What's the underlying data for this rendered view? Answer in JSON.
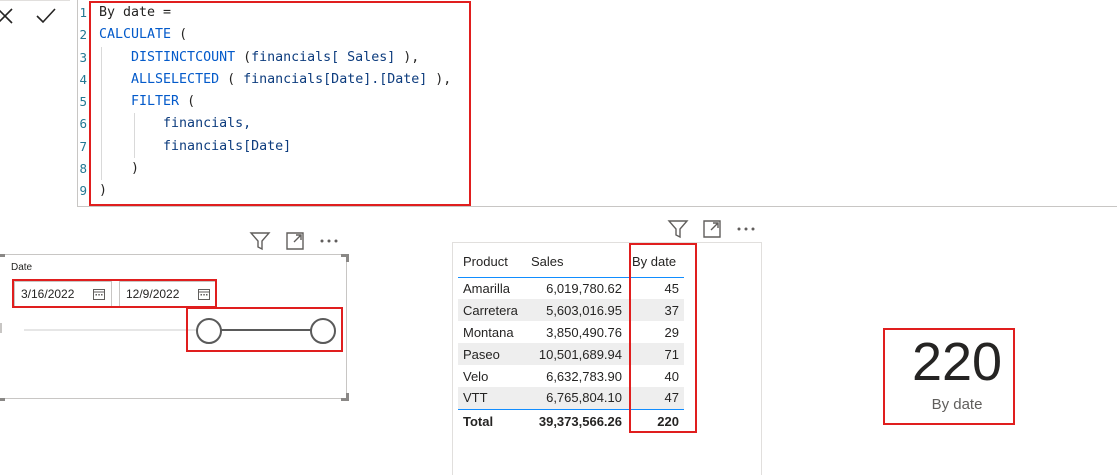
{
  "formula_bar": {
    "cancel_icon": "close-icon",
    "commit_icon": "checkmark-icon",
    "lines": [
      {
        "num": "1",
        "tokens": [
          {
            "t": "By date =",
            "c": "pu"
          }
        ]
      },
      {
        "num": "2",
        "tokens": [
          {
            "t": "CALCULATE",
            "c": "kw"
          },
          {
            "t": " (",
            "c": "pu"
          }
        ]
      },
      {
        "num": "3",
        "tokens": [
          {
            "t": "    DISTINCTCOUNT",
            "c": "fn"
          },
          {
            "t": " (",
            "c": "pu"
          },
          {
            "t": "financials[ Sales]",
            "c": "col"
          },
          {
            "t": " ),",
            "c": "pu"
          }
        ]
      },
      {
        "num": "4",
        "tokens": [
          {
            "t": "    ALLSELECTED",
            "c": "fn"
          },
          {
            "t": " ( ",
            "c": "pu"
          },
          {
            "t": "financials[Date].[Date]",
            "c": "col"
          },
          {
            "t": " ),",
            "c": "pu"
          }
        ]
      },
      {
        "num": "5",
        "tokens": [
          {
            "t": "    FILTER",
            "c": "kw"
          },
          {
            "t": " (",
            "c": "pu"
          }
        ]
      },
      {
        "num": "6",
        "tokens": [
          {
            "t": "        financials,",
            "c": "col"
          }
        ]
      },
      {
        "num": "7",
        "tokens": [
          {
            "t": "        financials[Date]",
            "c": "col"
          }
        ]
      },
      {
        "num": "8",
        "tokens": [
          {
            "t": "    )",
            "c": "pu"
          }
        ]
      },
      {
        "num": "9",
        "tokens": [
          {
            "t": ")",
            "c": "pu"
          }
        ]
      }
    ]
  },
  "slicer": {
    "title": "Date",
    "start_date": "3/16/2022",
    "end_date": "12/9/2022",
    "header_icons": [
      "filter-icon",
      "focus-mode-icon",
      "more-options-icon"
    ]
  },
  "table": {
    "header_icons": [
      "filter-icon",
      "focus-mode-icon",
      "more-options-icon"
    ],
    "columns": [
      "Product",
      "Sales",
      "By date"
    ],
    "rows": [
      [
        "Amarilla",
        "6,019,780.62",
        "45"
      ],
      [
        "Carretera",
        "5,603,016.95",
        "37"
      ],
      [
        "Montana",
        "3,850,490.76",
        "29"
      ],
      [
        "Paseo",
        "10,501,689.94",
        "71"
      ],
      [
        "Velo",
        "6,632,783.90",
        "40"
      ],
      [
        "VTT",
        "6,765,804.10",
        "47"
      ]
    ],
    "total": [
      "Total",
      "39,373,566.26",
      "220"
    ]
  },
  "card": {
    "value": "220",
    "label": "By date"
  },
  "colors": {
    "highlight": "#e01e1e",
    "accent": "#118dff",
    "keyword": "#035aca"
  }
}
